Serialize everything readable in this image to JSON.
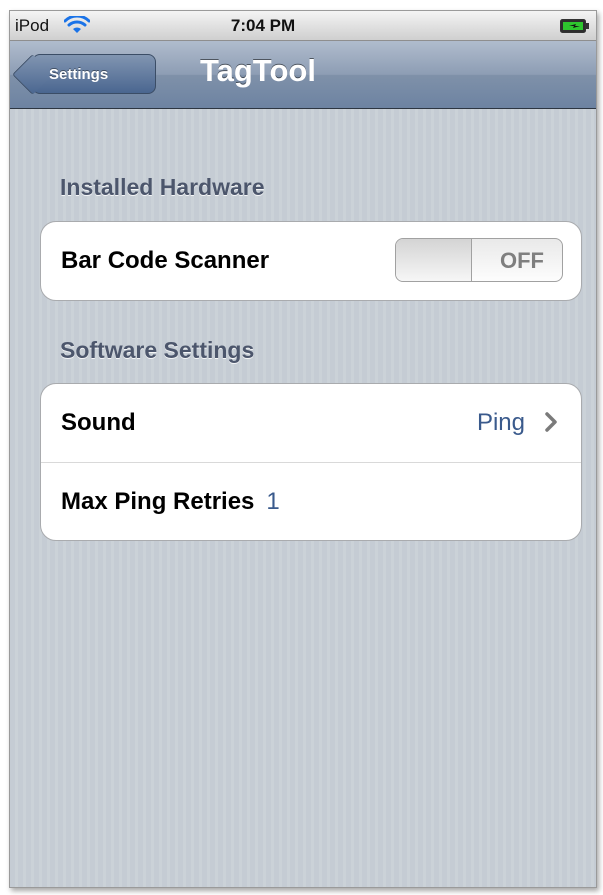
{
  "status_bar": {
    "carrier": "iPod",
    "time": "7:04 PM",
    "icons": [
      "wifi-icon",
      "battery-icon"
    ]
  },
  "nav_bar": {
    "back_label": "Settings",
    "title": "TagTool"
  },
  "sections": {
    "installed_hardware": {
      "header": "Installed Hardware",
      "rows": {
        "bar_code_scanner": {
          "label": "Bar Code Scanner",
          "switch_state": "OFF"
        }
      }
    },
    "software_settings": {
      "header": "Software Settings",
      "rows": {
        "sound": {
          "label": "Sound",
          "value": "Ping"
        },
        "max_ping_retries": {
          "label": "Max Ping Retries",
          "value": "1"
        }
      }
    }
  },
  "colors": {
    "nav_bar": "#6d83a2",
    "background_stripe": "#c5ccd4",
    "value_text": "#3a5a8c",
    "section_header": "#4c566c"
  }
}
